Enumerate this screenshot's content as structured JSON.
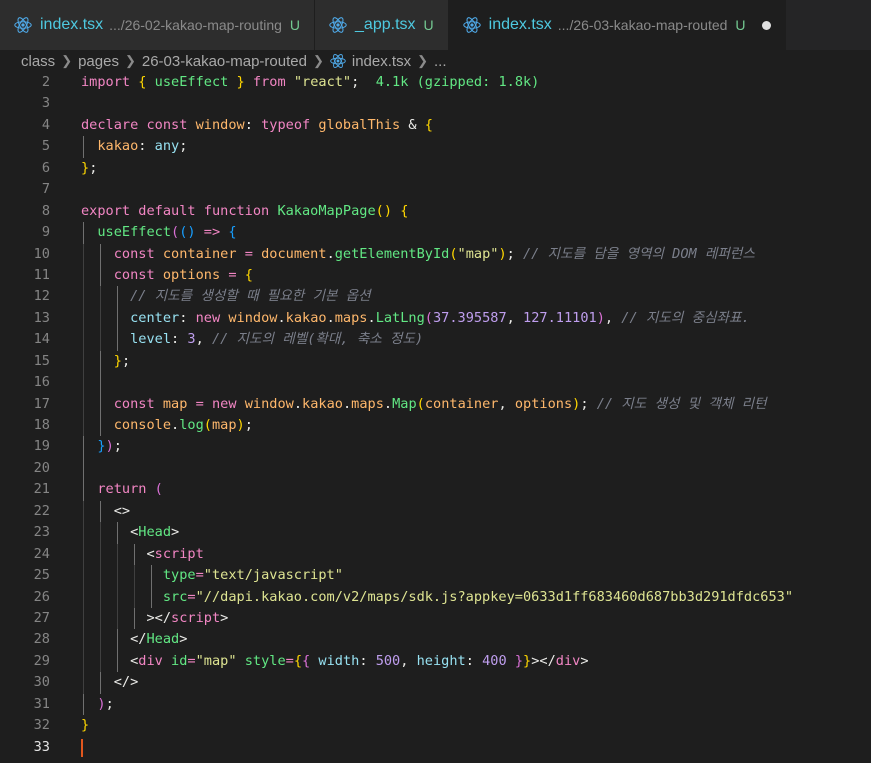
{
  "tabs": [
    {
      "name": "index.tsx",
      "path": ".../26-02-kakao-map-routing",
      "status": "U",
      "active": false
    },
    {
      "name": "_app.tsx",
      "path": "",
      "status": "U",
      "active": false
    },
    {
      "name": "index.tsx",
      "path": ".../26-03-kakao-map-routed",
      "status": "U",
      "active": true
    }
  ],
  "breadcrumb": [
    "class",
    "pages",
    "26-03-kakao-map-routed",
    "index.tsx",
    "..."
  ],
  "colors": {
    "accent_cursor": "#e2571e",
    "react_icon": "#4fa9e8",
    "untracked": "#73c991"
  },
  "editor": {
    "current_line": 33,
    "lines": [
      {
        "n": 2,
        "parts": [
          [
            "k",
            "import "
          ],
          [
            "b1",
            "{ "
          ],
          [
            "f",
            "useEffect"
          ],
          [
            "b1",
            " }"
          ],
          [
            "k",
            " from "
          ],
          [
            "s",
            "\"react\""
          ],
          [
            "v",
            ";  "
          ],
          [
            "hint",
            "4.1k (gzipped: 1.8k)"
          ]
        ]
      },
      {
        "n": 3,
        "parts": []
      },
      {
        "n": 4,
        "parts": [
          [
            "k",
            "declare "
          ],
          [
            "kb",
            "const "
          ],
          [
            "orng",
            "window"
          ],
          [
            "v",
            ": "
          ],
          [
            "kb",
            "typeof "
          ],
          [
            "orng",
            "globalThis"
          ],
          [
            "v",
            " & "
          ],
          [
            "b1",
            "{"
          ]
        ]
      },
      {
        "n": 5,
        "parts": [
          [
            "v",
            "  "
          ],
          [
            "orng",
            "kakao"
          ],
          [
            "v",
            ": "
          ],
          [
            "t",
            "any"
          ],
          [
            "v",
            ";"
          ]
        ]
      },
      {
        "n": 6,
        "parts": [
          [
            "b1",
            "}"
          ],
          [
            "v",
            ";"
          ]
        ]
      },
      {
        "n": 7,
        "parts": []
      },
      {
        "n": 8,
        "parts": [
          [
            "k",
            "export default "
          ],
          [
            "kb",
            "function "
          ],
          [
            "f",
            "KakaoMapPage"
          ],
          [
            "b1",
            "() {"
          ]
        ]
      },
      {
        "n": 9,
        "parts": [
          [
            "v",
            "  "
          ],
          [
            "f",
            "useEffect"
          ],
          [
            "b2",
            "("
          ],
          [
            "b3",
            "() "
          ],
          [
            "kb",
            "=> "
          ],
          [
            "b3",
            "{"
          ]
        ]
      },
      {
        "n": 10,
        "parts": [
          [
            "v",
            "    "
          ],
          [
            "kb",
            "const "
          ],
          [
            "orng",
            "container "
          ],
          [
            "kb",
            "= "
          ],
          [
            "orng",
            "document"
          ],
          [
            "v",
            "."
          ],
          [
            "f",
            "getElementById"
          ],
          [
            "b1",
            "("
          ],
          [
            "s",
            "\"map\""
          ],
          [
            "b1",
            ")"
          ],
          [
            "v",
            "; "
          ],
          [
            "c",
            "// 지도를 담을 영역의 DOM 레퍼런스"
          ]
        ]
      },
      {
        "n": 11,
        "parts": [
          [
            "v",
            "    "
          ],
          [
            "kb",
            "const "
          ],
          [
            "orng",
            "options "
          ],
          [
            "kb",
            "= "
          ],
          [
            "b1",
            "{"
          ]
        ]
      },
      {
        "n": 12,
        "parts": [
          [
            "v",
            "      "
          ],
          [
            "c",
            "// 지도를 생성할 때 필요한 기본 옵션"
          ]
        ]
      },
      {
        "n": 13,
        "parts": [
          [
            "v",
            "      "
          ],
          [
            "prop",
            "center"
          ],
          [
            "v",
            ": "
          ],
          [
            "kb",
            "new "
          ],
          [
            "orng",
            "window"
          ],
          [
            "v",
            "."
          ],
          [
            "orng",
            "kakao"
          ],
          [
            "v",
            "."
          ],
          [
            "orng",
            "maps"
          ],
          [
            "v",
            "."
          ],
          [
            "f",
            "LatLng"
          ],
          [
            "b2",
            "("
          ],
          [
            "n",
            "37.395587"
          ],
          [
            "v",
            ", "
          ],
          [
            "n",
            "127.11101"
          ],
          [
            "b2",
            ")"
          ],
          [
            "v",
            ", "
          ],
          [
            "c",
            "// 지도의 중심좌표."
          ]
        ]
      },
      {
        "n": 14,
        "parts": [
          [
            "v",
            "      "
          ],
          [
            "prop",
            "level"
          ],
          [
            "v",
            ": "
          ],
          [
            "n",
            "3"
          ],
          [
            "v",
            ", "
          ],
          [
            "c",
            "// 지도의 레벨(확대, 축소 정도)"
          ]
        ]
      },
      {
        "n": 15,
        "parts": [
          [
            "v",
            "    "
          ],
          [
            "b1",
            "}"
          ],
          [
            "v",
            ";"
          ]
        ]
      },
      {
        "n": 16,
        "parts": []
      },
      {
        "n": 17,
        "parts": [
          [
            "v",
            "    "
          ],
          [
            "kb",
            "const "
          ],
          [
            "orng",
            "map "
          ],
          [
            "kb",
            "= "
          ],
          [
            "kb",
            "new "
          ],
          [
            "orng",
            "window"
          ],
          [
            "v",
            "."
          ],
          [
            "orng",
            "kakao"
          ],
          [
            "v",
            "."
          ],
          [
            "orng",
            "maps"
          ],
          [
            "v",
            "."
          ],
          [
            "f",
            "Map"
          ],
          [
            "b1",
            "("
          ],
          [
            "orng",
            "container"
          ],
          [
            "v",
            ", "
          ],
          [
            "orng",
            "options"
          ],
          [
            "b1",
            ")"
          ],
          [
            "v",
            "; "
          ],
          [
            "c",
            "// 지도 생성 및 객체 리턴"
          ]
        ]
      },
      {
        "n": 18,
        "parts": [
          [
            "v",
            "    "
          ],
          [
            "orng",
            "console"
          ],
          [
            "v",
            "."
          ],
          [
            "f",
            "log"
          ],
          [
            "b1",
            "("
          ],
          [
            "orng",
            "map"
          ],
          [
            "b1",
            ")"
          ],
          [
            "v",
            ";"
          ]
        ]
      },
      {
        "n": 19,
        "parts": [
          [
            "v",
            "  "
          ],
          [
            "b3",
            "}"
          ],
          [
            "b2",
            ")"
          ],
          [
            "v",
            ";"
          ]
        ]
      },
      {
        "n": 20,
        "parts": []
      },
      {
        "n": 21,
        "parts": [
          [
            "v",
            "  "
          ],
          [
            "k",
            "return "
          ],
          [
            "b2",
            "("
          ]
        ]
      },
      {
        "n": 22,
        "parts": [
          [
            "v",
            "    "
          ],
          [
            "v",
            "<>"
          ]
        ]
      },
      {
        "n": 23,
        "parts": [
          [
            "v",
            "      <"
          ],
          [
            "f",
            "Head"
          ],
          [
            "v",
            ">"
          ]
        ]
      },
      {
        "n": 24,
        "parts": [
          [
            "v",
            "        <"
          ],
          [
            "tg",
            "script"
          ]
        ]
      },
      {
        "n": 25,
        "parts": [
          [
            "v",
            "          "
          ],
          [
            "at",
            "type"
          ],
          [
            "kb",
            "="
          ],
          [
            "s",
            "\"text/javascript\""
          ]
        ]
      },
      {
        "n": 26,
        "parts": [
          [
            "v",
            "          "
          ],
          [
            "at",
            "src"
          ],
          [
            "kb",
            "="
          ],
          [
            "s",
            "\"//dapi.kakao.com/v2/maps/sdk.js?appkey=0633d1ff683460d687bb3d291dfdc653\""
          ]
        ]
      },
      {
        "n": 27,
        "parts": [
          [
            "v",
            "        ></"
          ],
          [
            "tg",
            "script"
          ],
          [
            "v",
            ">"
          ]
        ]
      },
      {
        "n": 28,
        "parts": [
          [
            "v",
            "      </"
          ],
          [
            "f",
            "Head"
          ],
          [
            "v",
            ">"
          ]
        ]
      },
      {
        "n": 29,
        "parts": [
          [
            "v",
            "      <"
          ],
          [
            "tg",
            "div "
          ],
          [
            "at",
            "id"
          ],
          [
            "kb",
            "="
          ],
          [
            "s",
            "\"map\" "
          ],
          [
            "at",
            "style"
          ],
          [
            "kb",
            "="
          ],
          [
            "b1",
            "{"
          ],
          [
            "b2",
            "{ "
          ],
          [
            "prop",
            "width"
          ],
          [
            "v",
            ": "
          ],
          [
            "n",
            "500"
          ],
          [
            "v",
            ", "
          ],
          [
            "prop",
            "height"
          ],
          [
            "v",
            ": "
          ],
          [
            "n",
            "400"
          ],
          [
            "b2",
            " }"
          ],
          [
            "b1",
            "}"
          ],
          [
            "v",
            "></"
          ],
          [
            "tg",
            "div"
          ],
          [
            "v",
            ">"
          ]
        ]
      },
      {
        "n": 30,
        "parts": [
          [
            "v",
            "    </>"
          ]
        ]
      },
      {
        "n": 31,
        "parts": [
          [
            "v",
            "  "
          ],
          [
            "b2",
            ")"
          ],
          [
            "v",
            ";"
          ]
        ]
      },
      {
        "n": 32,
        "parts": [
          [
            "b1",
            "}"
          ]
        ]
      },
      {
        "n": 33,
        "parts": []
      }
    ]
  }
}
